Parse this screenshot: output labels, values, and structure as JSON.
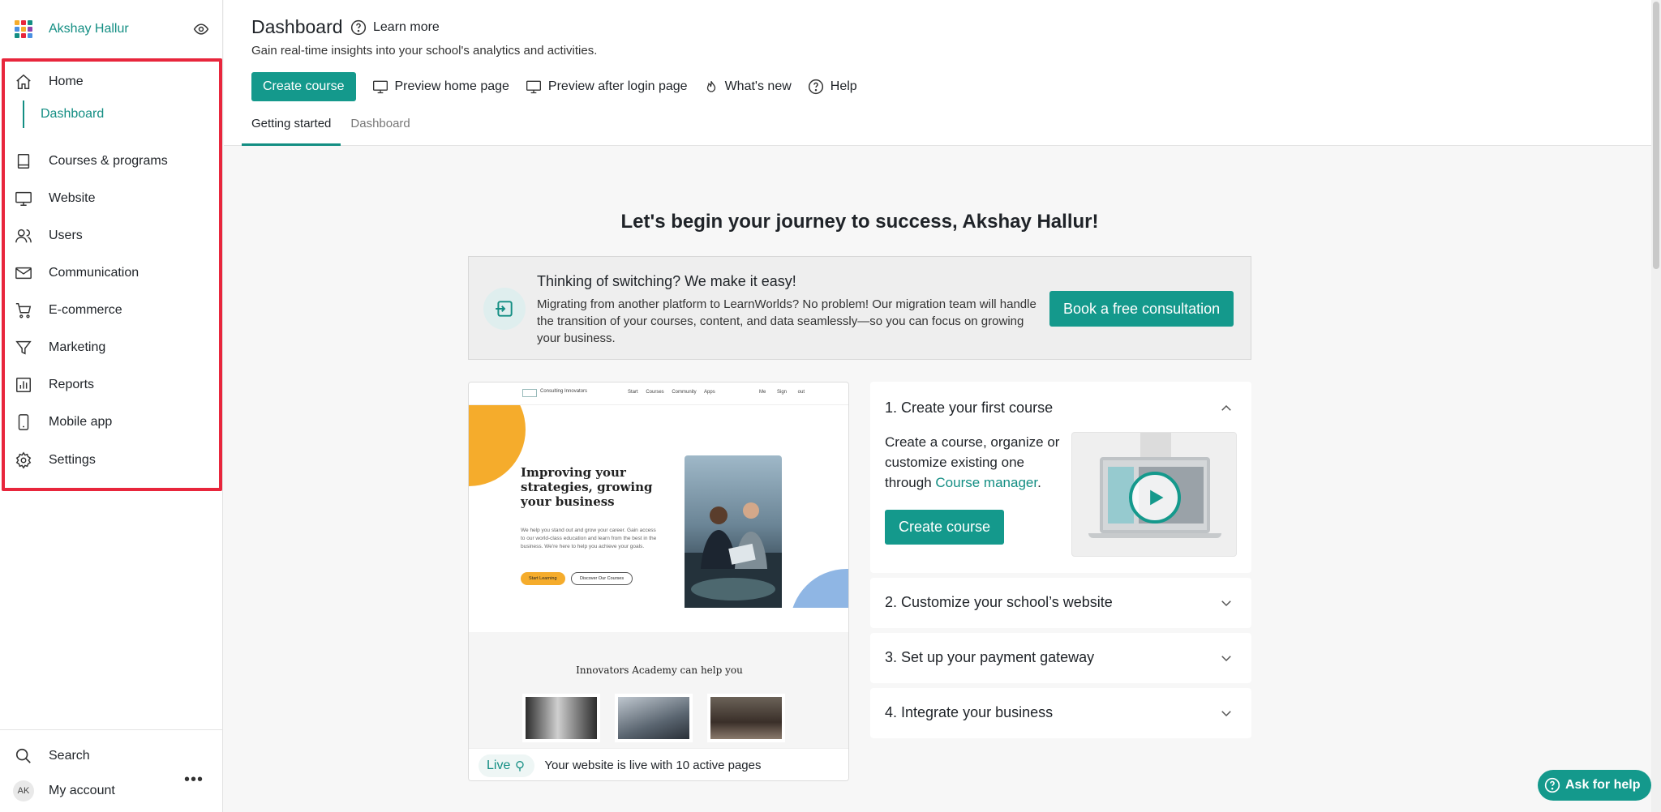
{
  "sidebar": {
    "user_name": "Akshay Hallur",
    "logo_colors": [
      "#f5ac2c",
      "#e8263c",
      "#138e83",
      "#4a90e2",
      "#f5ac2c",
      "#8e44ad",
      "#138e83",
      "#e8263c",
      "#4a90e2"
    ],
    "nav": {
      "home": "Home",
      "dashboard": "Dashboard",
      "courses": "Courses & programs",
      "website": "Website",
      "users": "Users",
      "communication": "Communication",
      "ecommerce": "E-commerce",
      "marketing": "Marketing",
      "reports": "Reports",
      "mobile_app": "Mobile app",
      "settings": "Settings"
    },
    "search": "Search",
    "account_initials": "AK",
    "my_account": "My account",
    "more": "•••"
  },
  "header": {
    "title": "Dashboard",
    "learn_more": "Learn more",
    "subtitle": "Gain real-time insights into your school's analytics and activities.",
    "create_course": "Create course",
    "preview_home": "Preview home page",
    "preview_after_login": "Preview after login page",
    "whats_new": "What's new",
    "help": "Help",
    "tabs": {
      "getting_started": "Getting started",
      "dashboard": "Dashboard"
    }
  },
  "main": {
    "hero_title": "Let's begin your journey to success, Akshay Hallur!",
    "switch": {
      "title": "Thinking of switching? We make it easy!",
      "body": "Migrating from another platform to LearnWorlds? No problem! Our migration team will handle the transition of your courses, content, and data seamlessly—so you can focus on growing your business.",
      "button": "Book a free consultation"
    },
    "preview": {
      "site_name": "Consulting Innovators",
      "menu": "Start Courses Community Apps",
      "account": "Me Sign out",
      "heading": "Improving your strategies, growing your business",
      "text": "We help you stand out and grow your career. Gain access to our world-class education and learn from the best in the business. We're here to help you achieve your goals.",
      "btn_start": "Start Learning",
      "btn_discover": "Discover Our Courses",
      "section_title": "Innovators Academy can help you",
      "live_label": "Live",
      "live_text": "Your website is live with 10 active pages"
    },
    "steps": {
      "step1_title": "1. Create your first course",
      "step1_desc_pre": "Create a course, organize or customize existing one through ",
      "step1_link": "Course manager",
      "step1_desc_post": ".",
      "step1_button": "Create course",
      "step2_title": "2. Customize your school’s website",
      "step3_title": "3. Set up your payment gateway",
      "step4_title": "4. Integrate your business"
    }
  },
  "help_button": "Ask for help",
  "colors": {
    "accent": "#14998c",
    "highlight_border": "#e8263c"
  }
}
